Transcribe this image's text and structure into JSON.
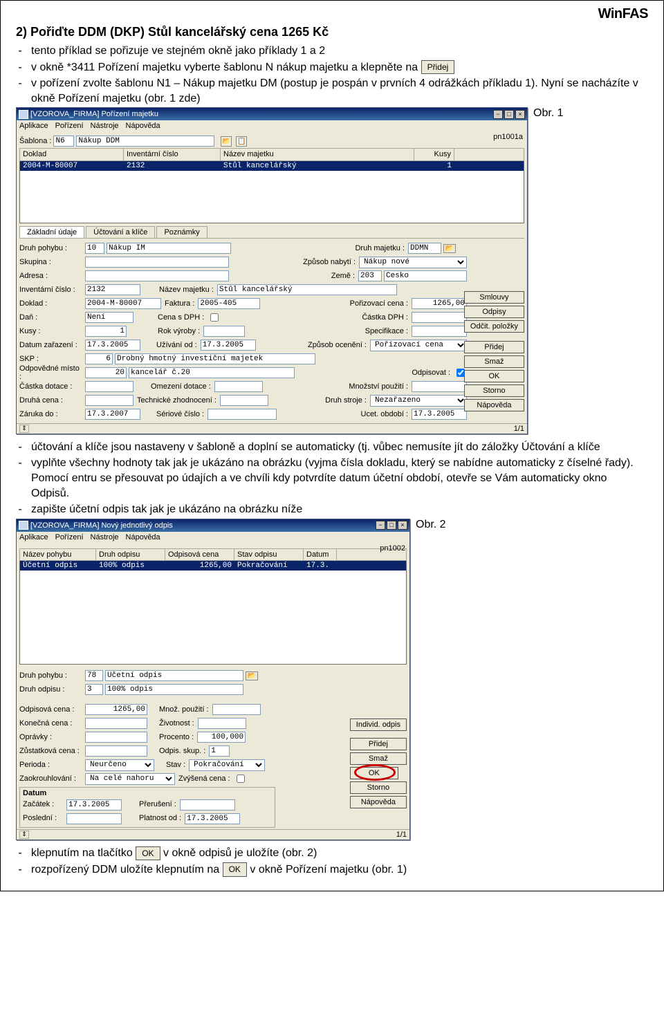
{
  "brand": "WinFAS",
  "heading": "2) Pořiďte DDM (DKP) Stůl kancelářský cena 1265 Kč",
  "intro": [
    "tento příklad se pořizuje ve stejném okně jako příklady 1 a 2",
    "v okně *3411 Pořízení majetku vyberte šablonu N nákup majetku a klepněte na",
    "v pořízení zvolte šablonu N1 – Nákup majetku DM (postup je pospán v prvních 4 odrážkách příkladu 1). Nyní se nacházíte v okně Pořízení majetku (obr. 1 zde)"
  ],
  "intro_btn": "Přidej",
  "fig1": "Obr. 1",
  "fig2": "Obr. 2",
  "mid_text": [
    "účtování a klíče jsou nastaveny v šabloně a doplní se automaticky (tj. vůbec nemusíte jít do záložky Účtování a klíče",
    "vyplňte všechny hodnoty tak jak je ukázáno na obrázku (vyjma čísla dokladu, který se nabídne automaticky z číselné řady). Pomocí entru se přesouvat po údajích a ve chvíli kdy potvrdíte datum účetní období, otevře se Vám automaticky okno Odpisů.",
    "zapište účetní odpis tak jak je ukázáno na obrázku níže"
  ],
  "bottom": [
    "klepnutím na tlačítko",
    "v okně odpisů je uložíte (obr. 2)",
    "rozpořízený DDM uložíte klepnutím na",
    "v okně Pořízení majetku (obr. 1)"
  ],
  "ok_btn": "OK",
  "win1": {
    "title": "[VZOROVA_FIRMA] Pořízení majetku",
    "menu": [
      "Aplikace",
      "Pořízení",
      "Nástroje",
      "Nápověda"
    ],
    "code": "pn1001a",
    "sablona_lbl": "Šablona :",
    "sablona_code": "N6",
    "sablona_name": "Nákup DDM",
    "grid_headers": [
      "Doklad",
      "Inventární číslo",
      "Název majetku",
      "Kusy"
    ],
    "grid_row": [
      "2004-M-80007",
      "2132",
      "Stůl kancelářský",
      "1"
    ],
    "tabs": [
      "Základní údaje",
      "Účtování a klíče",
      "Poznámky"
    ],
    "labels": {
      "druh_pohybu": "Druh pohybu :",
      "druh_pohybu_v": "10",
      "druh_pohybu_t": "Nákup IM",
      "druh_majetku": "Druh majetku :",
      "druh_majetku_v": "DDMN",
      "skupina": "Skupina :",
      "zpusob_nabyti": "Způsob nabytí :",
      "zpusob_nabyti_v": "Nákup nové",
      "adresa": "Adresa :",
      "zeme": "Země :",
      "zeme_c": "203",
      "zeme_t": "Česko",
      "inv_cislo": "Inventární číslo :",
      "inv_cislo_v": "2132",
      "nazev_majetku": "Název majetku :",
      "nazev_majetku_v": "Stůl kancelářský",
      "doklad": "Doklad :",
      "doklad_v": "2004-M-80007",
      "faktura": "Faktura :",
      "faktura_v": "2005-405",
      "porizovaci": "Pořizovací cena :",
      "porizovaci_v": "1265,00",
      "dan": "Daň :",
      "dan_v": "Není",
      "cena_dph": "Cena s DPH :",
      "castka_dph": "Částka DPH :",
      "kusy": "Kusy :",
      "kusy_v": "1",
      "rok_vyroby": "Rok výroby :",
      "specifikace": "Specifikace :",
      "datum_zar": "Datum zařazení :",
      "datum_zar_v": "17.3.2005",
      "uzivani": "Užívání od :",
      "uzivani_v": "17.3.2005",
      "zpusob_oc": "Způsob ocenění :",
      "zpusob_oc_v": "Pořizovací cena",
      "skp": "SKP :",
      "skp_c": "6",
      "skp_t": "Drobný hmotný investiční majetek",
      "odpovedne": "Odpovědné místo :",
      "odpovedne_c": "20",
      "odpovedne_t": "kancelář č.20",
      "odpisovat": "Odpisovat :",
      "castka_dot": "Částka dotace :",
      "omezeni_dot": "Omezení dotace :",
      "mnozstvi": "Množství použití :",
      "druha_cena": "Druhá cena :",
      "tech_zhod": "Technické zhodnocení :",
      "druh_stroje": "Druh stroje :",
      "druh_stroje_v": "Nezařazeno",
      "zaruka": "Záruka do :",
      "zaruka_v": "17.3.2007",
      "seriove": "Sériové číslo :",
      "ucet_obd": "Ucet. období :",
      "ucet_obd_v": "17.3.2005"
    },
    "side_btns": [
      "Smlouvy",
      "Odpisy",
      "Odčit. položky",
      "Přidej",
      "Smaž",
      "OK",
      "Storno",
      "Nápověda"
    ],
    "status": "1/1"
  },
  "win2": {
    "title": "[VZOROVA_FIRMA] Nový jednotlivý odpis",
    "menu": [
      "Aplikace",
      "Pořízení",
      "Nástroje",
      "Nápověda"
    ],
    "code": "pn1002",
    "grid_headers": [
      "Název pohybu",
      "Druh odpisu",
      "Odpisová cena",
      "Stav odpisu",
      "Datum"
    ],
    "grid_row": [
      "Účetní odpis",
      "100% odpis",
      "1265,00",
      "Pokračování",
      "17.3."
    ],
    "labels": {
      "druh_pohybu": "Druh pohybu :",
      "druh_pohybu_c": "78",
      "druh_pohybu_t": "Účetní odpis",
      "druh_odpisu": "Druh odpisu :",
      "druh_odpisu_c": "3",
      "druh_odpisu_t": "100% odpis",
      "odpisova": "Odpisová cena :",
      "odpisova_v": "1265,00",
      "mnoz": "Množ. použití :",
      "konecna": "Konečná cena :",
      "zivotnost": "Životnost :",
      "opravky": "Oprávky :",
      "procento": "Procento :",
      "procento_v": "100,000",
      "zustatkova": "Zůstatková cena :",
      "odpis_skup": "Odpis. skup. :",
      "odpis_skup_v": "1",
      "perioda": "Perioda :",
      "perioda_v": "Neurčeno",
      "stav": "Stav :",
      "stav_v": "Pokračování",
      "zaokrouhl": "Zaokrouhlování :",
      "zaokrouhl_v": "Na celé nahoru",
      "zvysena": "Zvýšená cena :",
      "datum_hdr": "Datum",
      "zacatek": "Začátek :",
      "zacatek_v": "17.3.2005",
      "preruseni": "Přerušení :",
      "posledni": "Poslední :",
      "platnost": "Platnost od :",
      "platnost_v": "17.3.2005"
    },
    "side_btns": [
      "Individ. odpis",
      "Přidej",
      "Smaž",
      "OK",
      "Storno",
      "Nápověda"
    ],
    "status": "1/1"
  }
}
